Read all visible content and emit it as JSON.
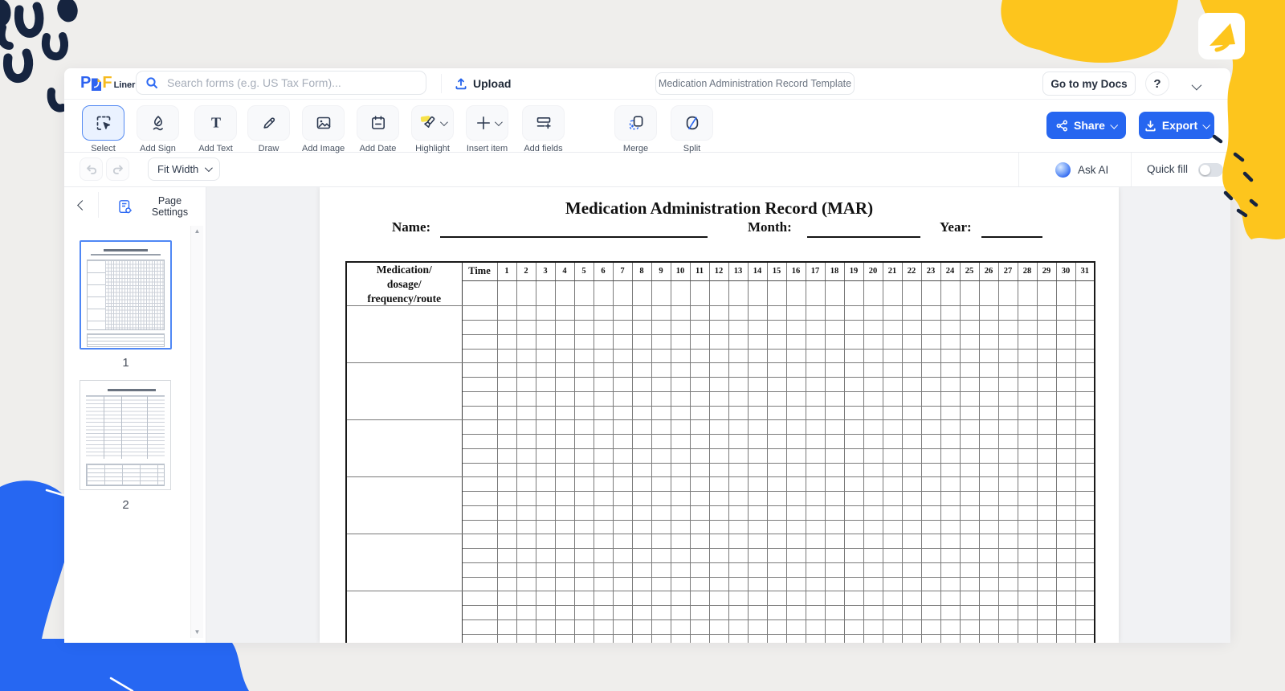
{
  "header": {
    "logo": {
      "p": "P",
      "f": "F",
      "suffix": "Liner"
    },
    "search_placeholder": "Search forms (e.g. US Tax Form)...",
    "upload_label": "Upload",
    "doc_title": "Medication Administration Record Template",
    "go_to_docs_label": "Go to my Docs",
    "help_label": "?"
  },
  "toolbar": {
    "buttons": [
      {
        "label": "Select"
      },
      {
        "label": "Add Sign"
      },
      {
        "label": "Add Text"
      },
      {
        "label": "Draw"
      },
      {
        "label": "Add Image"
      },
      {
        "label": "Add Date"
      },
      {
        "label": "Highlight"
      },
      {
        "label": "Insert item"
      },
      {
        "label": "Add fields"
      },
      {
        "label": "Merge"
      },
      {
        "label": "Split"
      }
    ],
    "share_label": "Share",
    "export_label": "Export"
  },
  "subtoolbar": {
    "zoom_value": "Fit Width",
    "ask_ai_label": "Ask AI",
    "quick_fill_label": "Quick fill",
    "quick_fill_on": false
  },
  "sidebar": {
    "page_settings_label": "Page Settings",
    "pages": [
      {
        "number": "1",
        "selected": true
      },
      {
        "number": "2",
        "selected": false
      }
    ]
  },
  "document": {
    "title": "Medication Administration Record (MAR)",
    "fields": [
      {
        "label": "Name:"
      },
      {
        "label": "Month:"
      },
      {
        "label": "Year:"
      }
    ],
    "table": {
      "medication_header_lines": [
        "Medication/",
        "dosage/",
        "frequency/route"
      ],
      "time_header": "Time",
      "days": [
        "1",
        "2",
        "3",
        "4",
        "5",
        "6",
        "7",
        "8",
        "9",
        "10",
        "11",
        "12",
        "13",
        "14",
        "15",
        "16",
        "17",
        "18",
        "19",
        "20",
        "21",
        "22",
        "23",
        "24",
        "25",
        "26",
        "27",
        "28",
        "29",
        "30",
        "31"
      ],
      "medication_blocks": 6,
      "rows_per_block": 4
    }
  },
  "colors": {
    "accent_blue": "#2666f0",
    "brand_yellow": "#fdc51d",
    "brand_navy": "#16243f",
    "blob_blue": "#2667f2"
  }
}
